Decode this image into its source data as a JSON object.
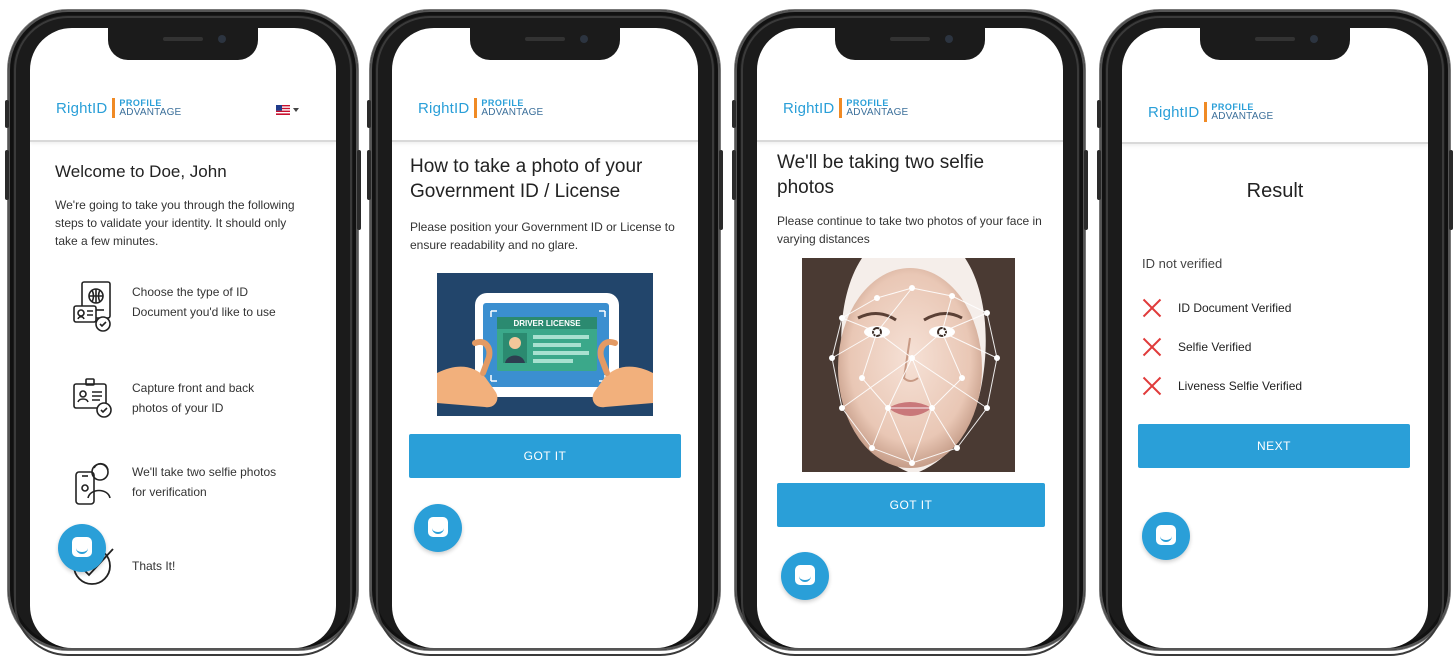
{
  "brand": {
    "name": "RightID",
    "sub1": "PROFILE",
    "sub2": "ADVANTAGE"
  },
  "screen1": {
    "title": "Welcome to Doe, John",
    "intro": "We're going to take you through the following steps to validate your identity. It should only take a few minutes.",
    "steps": [
      {
        "label": "Choose the type of ID Document you'd like to use",
        "icon": "passport-icon"
      },
      {
        "label": "Capture front and back photos of your ID",
        "icon": "id-card-icon"
      },
      {
        "label": "We'll take two selfie photos for verification",
        "icon": "selfie-icon"
      },
      {
        "label": "Thats It!",
        "icon": "checkmark-icon"
      }
    ]
  },
  "screen2": {
    "title": "How to take a photo of your Government ID / License",
    "text": "Please position your Government ID or License to ensure readability and no glare.",
    "image_label": "DRIVER LICENSE",
    "button": "GOT IT"
  },
  "screen3": {
    "title": "We'll be taking two selfie photos",
    "text": "Please continue to take two photos of your face in varying distances",
    "button": "GOT IT"
  },
  "screen4": {
    "title": "Result",
    "status": "ID not verified",
    "checks": [
      "ID Document Verified",
      "Selfie Verified",
      "Liveness Selfie Verified"
    ],
    "button": "NEXT"
  },
  "colors": {
    "accent": "#2a9fd8",
    "logo_bar": "#f08a24",
    "error": "#e03b3b"
  }
}
